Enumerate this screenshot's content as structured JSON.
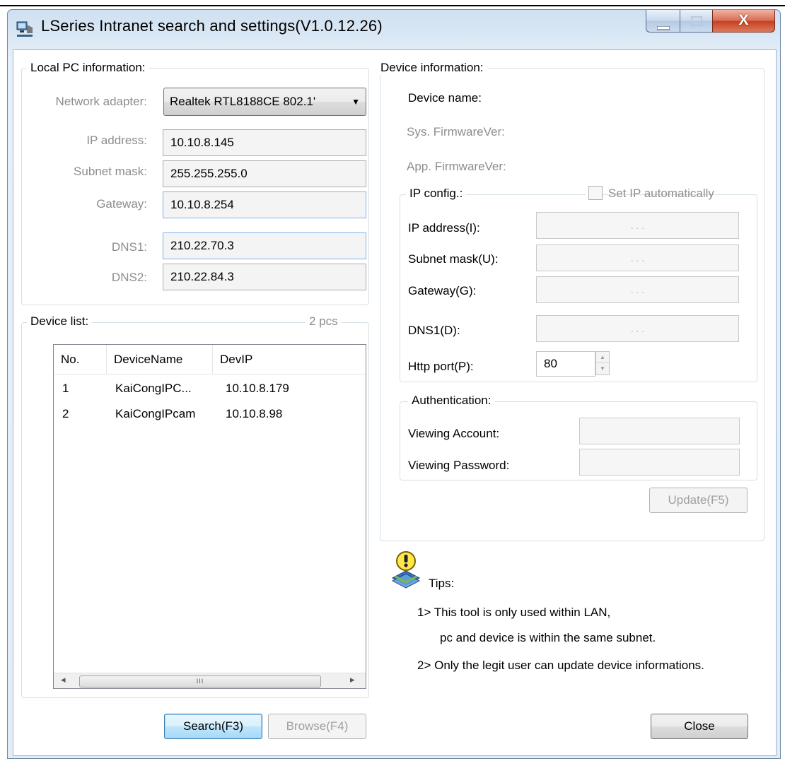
{
  "window": {
    "title": "LSeries Intranet search and settings(V1.0.12.26)",
    "controls": {
      "minimize": "–",
      "maximize": "□",
      "close": "X"
    }
  },
  "local_pc": {
    "legend": "Local PC information:",
    "network_adapter_label": "Network adapter:",
    "network_adapter_value": "Realtek RTL8188CE 802.1'",
    "ip_label": "IP address:",
    "ip_value": "10.10.8.145",
    "subnet_label": "Subnet mask:",
    "subnet_value": "255.255.255.0",
    "gateway_label": "Gateway:",
    "gateway_value": "10.10.8.254",
    "dns1_label": "DNS1:",
    "dns1_value": "210.22.70.3",
    "dns2_label": "DNS2:",
    "dns2_value": "210.22.84.3"
  },
  "device_list": {
    "legend": "Device list:",
    "count": "2 pcs",
    "columns": [
      "No.",
      "DeviceName",
      "DevIP"
    ],
    "rows": [
      {
        "no": "1",
        "name": "KaiCongIPC...",
        "ip": "10.10.8.179"
      },
      {
        "no": "2",
        "name": "KaiCongIPcam",
        "ip": "10.10.8.98"
      }
    ],
    "scroll_left": "◂",
    "scroll_grip": "III",
    "scroll_right": "▸"
  },
  "device_info": {
    "legend": "Device information:",
    "device_name_label": "Device name:",
    "sys_fw_label": "Sys. FirmwareVer:",
    "app_fw_label": "App. FirmwareVer:",
    "ip_config_legend": "IP config.:",
    "auto_ip_label": "Set IP automatically",
    "ip_label": "IP address(I):",
    "subnet_label": "Subnet mask(U):",
    "gateway_label": "Gateway(G):",
    "dns1_label": "DNS1(D):",
    "http_port_label": "Http port(P):",
    "http_port_value": "80",
    "ip_dots": ".            .            .",
    "auth_legend": "Authentication:",
    "viewing_account_label": "Viewing Account:",
    "viewing_password_label": "Viewing Password:",
    "update_button": "Update(F5)"
  },
  "tips": {
    "label": "Tips:",
    "line1": "1> This tool is only used within LAN,",
    "line2": "pc and device is within the same subnet.",
    "line3": "2> Only the legit user can update  device informations."
  },
  "buttons": {
    "search": "Search(F3)",
    "browse": "Browse(F4)",
    "close": "Close"
  }
}
